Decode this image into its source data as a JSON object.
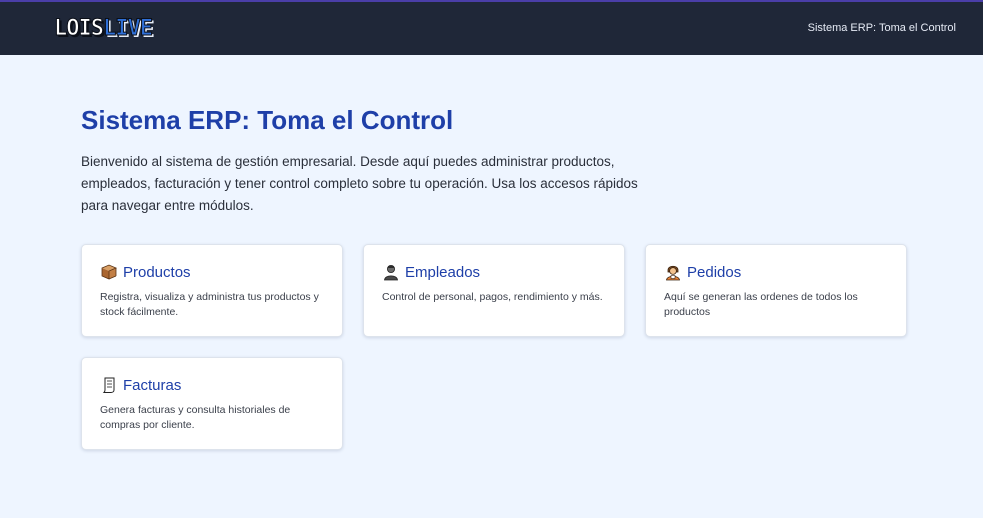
{
  "header": {
    "logo_part1": "LOIS",
    "logo_part2": "LIVE",
    "title": "Sistema ERP: Toma el Control"
  },
  "main": {
    "title": "Sistema ERP: Toma el Control",
    "intro": "Bienvenido al sistema de gestión empresarial. Desde aquí puedes administrar productos, empleados, facturación y tener control completo sobre tu operación. Usa los accesos rápidos para navegar entre módulos."
  },
  "cards": [
    {
      "title": "Productos",
      "description": "Registra, visualiza y administra tus productos y stock fácilmente.",
      "icon": "box-icon"
    },
    {
      "title": "Empleados",
      "description": "Control de personal, pagos, rendimiento y más.",
      "icon": "person-icon"
    },
    {
      "title": "Pedidos",
      "description": "Aquí se generan las ordenes de todos los productos",
      "icon": "clerk-icon"
    },
    {
      "title": "Facturas",
      "description": "Genera facturas y consulta historiales de compras por cliente.",
      "icon": "scroll-icon"
    }
  ],
  "colors": {
    "header_bg": "#1f2738",
    "page_bg": "#eef5ff",
    "accent": "#1e3fa8"
  }
}
